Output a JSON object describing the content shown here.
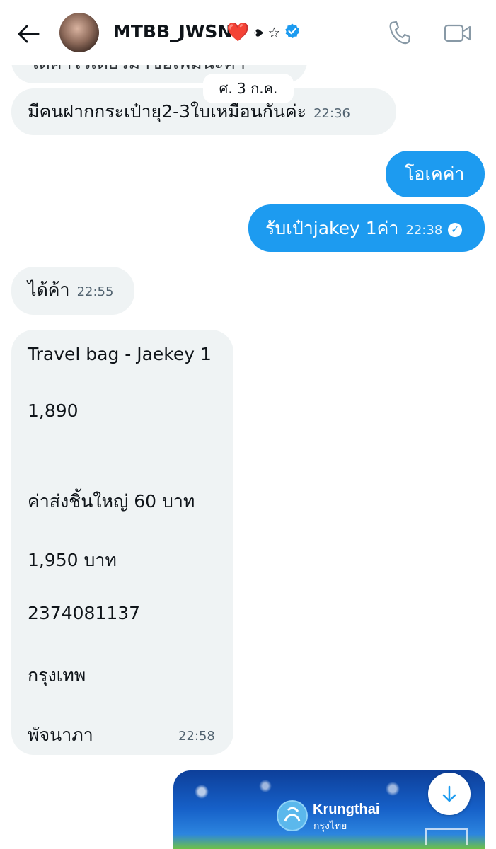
{
  "header": {
    "name": "MTBB_JWSN",
    "badge_heart": "❤️",
    "badge_spade": "♠",
    "badge_star": "☆",
    "icons": [
      "back-arrow-icon",
      "phone-icon",
      "video-camera-icon",
      "verified-badge-icon"
    ]
  },
  "messages": {
    "partial_top": "ได้ค่าไว้เดี๋ยวมาซื้อเพิ่มนะค่า",
    "date_chip": "ศ. 3 ก.ค.",
    "m1": {
      "text": "มีคนฝากกระเป๋ายุ2-3ใบเหมือนกันค่ะ",
      "time": "22:36"
    },
    "m2": {
      "text": "โอเคค่า"
    },
    "m3": {
      "text": "รับเป๋าjakey 1ค่า",
      "time": "22:38"
    },
    "m4": {
      "text": "ได้ค้า",
      "time": "22:55"
    },
    "card": {
      "lines": [
        "Travel bag - Jaekey 1",
        "1,890",
        "ค่าส่งชิ้นใหญ่ 60 บาท",
        "1,950 บาท",
        "2374081137",
        "กรุงเทพ",
        "พัจนาภา"
      ],
      "time": "22:58"
    },
    "image": {
      "brand": "Krungthai",
      "brand_thai": "กรุงไทย"
    }
  },
  "colors": {
    "incoming_bubble": "#eff3f4",
    "outgoing_bubble": "#1d9bf0",
    "verified": "#1d9bf0"
  }
}
